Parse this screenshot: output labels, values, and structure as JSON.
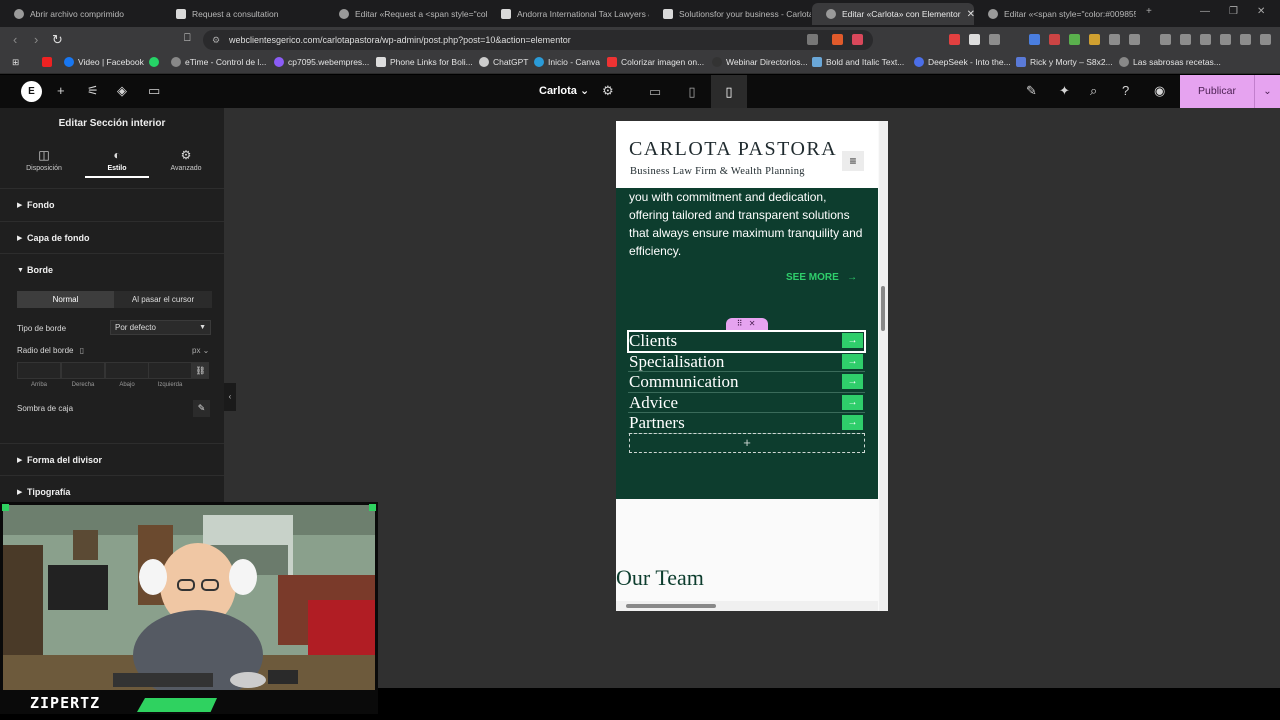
{
  "browser": {
    "tabs": [
      {
        "label": "Abrir archivo comprimido",
        "active": false
      },
      {
        "label": "Request a consultation",
        "active": false
      },
      {
        "label": "Editar «Request a <span style=\"colo",
        "active": false
      },
      {
        "label": "Andorra International Tax Lawyers &",
        "active": false
      },
      {
        "label": "Solutionsfor your business - Carlota",
        "active": false
      },
      {
        "label": "Editar «Carlota» con Elementor",
        "active": true
      },
      {
        "label": "Editar «<span style=\"color:#009855",
        "active": false
      }
    ],
    "new_tab": "+",
    "url": "webclientesgerico.com/carlotapastora/wp-admin/post.php?post=10&action=elementor",
    "bookmarks": [
      "Video | Facebook",
      "eTime - Control de l...",
      "cp7095.webempres...",
      "Phone Links for Boli...",
      "ChatGPT",
      "Inicio - Canva",
      "Colorizar imagen on...",
      "Webinar Directorios...",
      "Bold and Italic Text...",
      "DeepSeek - Into the...",
      "Rick y Morty – S8x2...",
      "Las sabrosas recetas..."
    ]
  },
  "editor": {
    "page_name": "Carlota",
    "publish_label": "Publicar",
    "panel": {
      "title": "Editar Sección interior",
      "tabs": [
        "Disposición",
        "Estilo",
        "Avanzado"
      ],
      "sections": {
        "fondo": "Fondo",
        "capa": "Capa de fondo",
        "borde": "Borde",
        "divisor": "Forma del divisor",
        "tipografia": "Tipografía"
      },
      "state_normal": "Normal",
      "state_hover": "Al pasar el cursor",
      "border_type_label": "Tipo de borde",
      "border_type_value": "Por defecto",
      "radius_label": "Radio del borde",
      "unit": "px",
      "dims": [
        "Arriba",
        "Derecha",
        "Abajo",
        "Izquierda"
      ],
      "shadow_label": "Sombra de caja"
    }
  },
  "preview": {
    "brand": "CARLOTA PASTORA",
    "tagline": "Business Law Firm & Wealth Planning",
    "paragraph": "you with commitment and dedication, offering tailored and transparent solutions that always ensure maximum tranquility and efficiency.",
    "see_more": "SEE MORE",
    "list": [
      "Clients",
      "Specialisation",
      "Communication",
      "Advice",
      "Partners"
    ],
    "add": "+",
    "team_heading": "Our Team"
  },
  "overlay": {
    "name": "ZIPERTZ"
  },
  "colors": {
    "accent_green": "#2fce6b",
    "section_green": "#0d3d2e",
    "publish_pink": "#e6a3f0"
  }
}
